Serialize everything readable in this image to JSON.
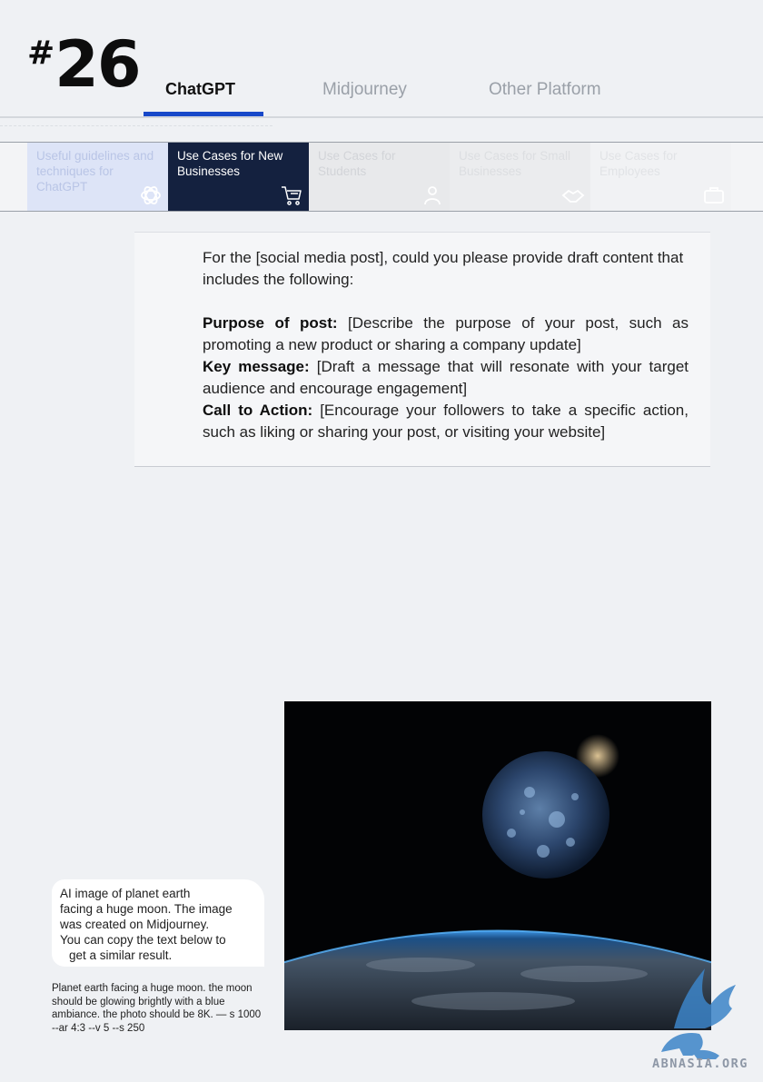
{
  "header": {
    "hash": "#",
    "number": "26",
    "tabs": [
      {
        "label": "ChatGPT",
        "active": true
      },
      {
        "label": "Midjourney",
        "active": false
      },
      {
        "label": "Other Platform",
        "active": false
      }
    ]
  },
  "categories": [
    {
      "label": "Useful guidelines and techniques for ChatGPT",
      "icon": "openai-icon",
      "active": false
    },
    {
      "label": "Use Cases for New Businesses",
      "icon": "cart-icon",
      "active": true
    },
    {
      "label": "Use Cases for Students",
      "icon": "student-icon",
      "active": false
    },
    {
      "label": "Use Cases for Small Businesses",
      "icon": "handshake-icon",
      "active": false
    },
    {
      "label": "Use Cases for Employees",
      "icon": "briefcase-icon",
      "active": false
    }
  ],
  "prompt": {
    "intro": "For the [social media post], could you please provide draft content that includes the following:",
    "items": [
      {
        "label": "Purpose of post:",
        "text": " [Describe the purpose of your post, such as promoting a new product or sharing a company update]"
      },
      {
        "label": "Key message:",
        "text": " [Draft a message that will resonate with your target audience and encourage engagement]"
      },
      {
        "label": "Call to Action:",
        "text": " [Encourage your followers to take a specific action, such as liking or sharing your post, or visiting your website]"
      }
    ]
  },
  "caption": {
    "lines": [
      "AI image of planet earth",
      "facing a huge moon. The image",
      "was created on Midjourney.",
      "You can copy the text below to",
      "get a similar result."
    ],
    "prompt_text": "Planet earth facing a huge moon. the moon should be glowing brightly with a blue ambiance. the photo should be 8K. — s 1000 --ar 4:3 --v 5 --s 250"
  },
  "watermark": {
    "text": "ABNASIA.ORG"
  },
  "colors": {
    "accent": "#1748c9",
    "active_category": "#14213f",
    "background": "#eff1f4"
  }
}
